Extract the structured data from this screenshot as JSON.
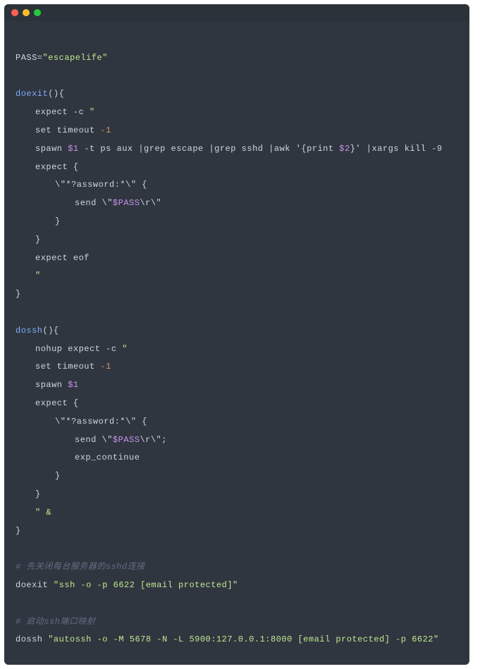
{
  "window": {
    "titlebar_dots": [
      "red",
      "yellow",
      "green"
    ]
  },
  "code": {
    "l1a": "PASS=",
    "l1b": "\"escapelife\"",
    "l2a": "doexit",
    "l2b": "(){",
    "l3a": "expect -c ",
    "l3b": "\"",
    "l4a": "set timeout ",
    "l4b": "-1",
    "l5a": "spawn ",
    "l5b": "$1",
    "l5c": " -t ps aux |grep escape |grep sshd |awk '{print ",
    "l5d": "$2",
    "l5e": "}' |xargs kill -9",
    "l6": "expect {",
    "l7": "\\\"*?assword:*\\\" {",
    "l8a": "send \\\"",
    "l8b": "$PASS",
    "l8c": "\\r\\\"",
    "l9": "}",
    "l10": "}",
    "l11": "expect eof",
    "l12": "\"",
    "l13": "}",
    "l14a": "dossh",
    "l14b": "(){",
    "l15a": "nohup expect -c ",
    "l15b": "\"",
    "l16a": "set timeout ",
    "l16b": "-1",
    "l17a": "spawn ",
    "l17b": "$1",
    "l18": "expect {",
    "l19": "\\\"*?assword:*\\\" {",
    "l20a": "send \\\"",
    "l20b": "$PASS",
    "l20c": "\\r\\\";",
    "l21": "exp_continue",
    "l22": "}",
    "l23": "}",
    "l24": "\" &",
    "l25": "}",
    "c1": "# 先关闭每台服务器的sshd连接",
    "l26a": "doexit ",
    "l26b": "\"ssh -o -p 6622 [email protected]\"",
    "c2": "# 启动ssh端口映射",
    "l27a": "dossh ",
    "l27b": "\"autossh -o -M 5678 -N -L 5900:127.0.0.1:8000 [email protected] -p 6622\""
  }
}
